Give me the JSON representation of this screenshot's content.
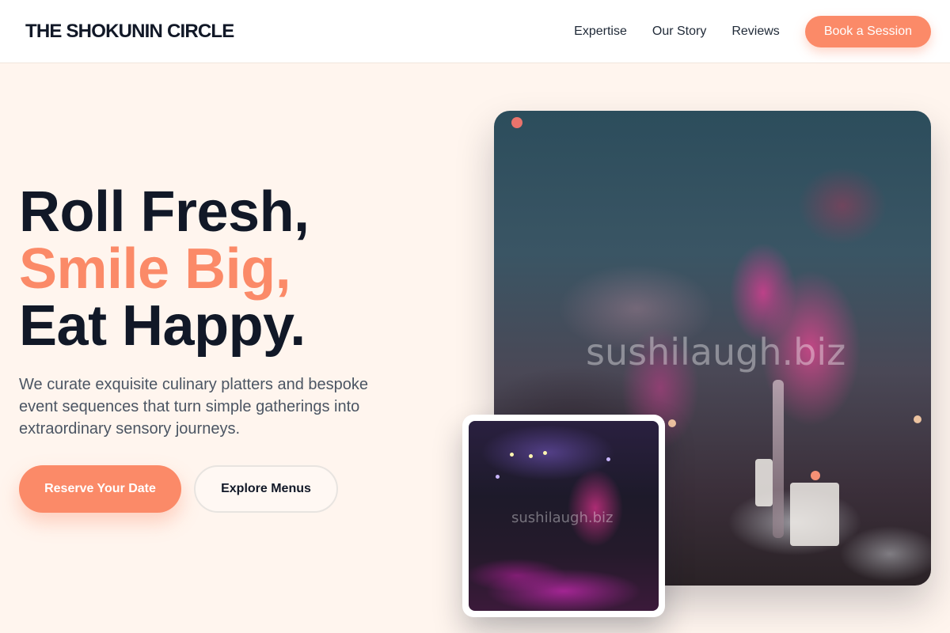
{
  "brand": {
    "name": "THE SHOKUNIN CIRCLE"
  },
  "nav": {
    "links": [
      "Expertise",
      "Our Story",
      "Reviews"
    ],
    "cta": "Book a Session"
  },
  "hero": {
    "headline": [
      "Roll Fresh,",
      "Smile Big,",
      "Eat Happy."
    ],
    "description": "We curate exquisite culinary platters and bespoke event sequences that turn simple gatherings into extraordinary sensory journeys.",
    "primary_button": "Reserve Your Date",
    "secondary_button": "Explore Menus"
  },
  "images": {
    "main_watermark": "sushilaugh.biz",
    "inset_watermark": "sushilaugh.biz"
  },
  "colors": {
    "accent": "#fb8a68",
    "heading": "#111827",
    "background": "#fff5ee",
    "body_text": "#4b5563"
  }
}
